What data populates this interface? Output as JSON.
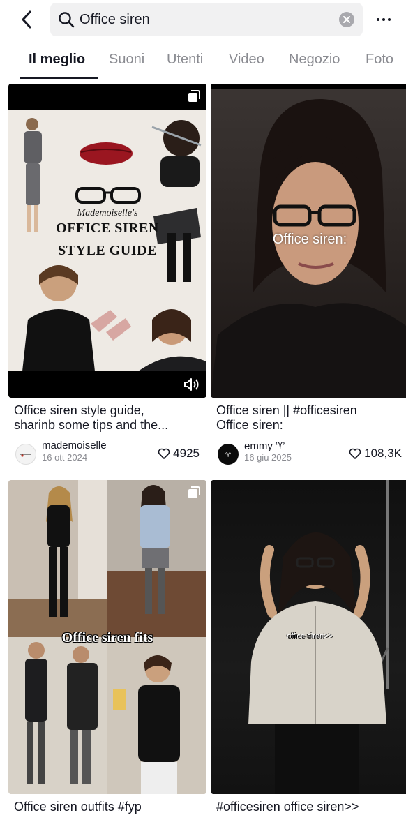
{
  "search": {
    "query": "Office siren"
  },
  "tabs": [
    {
      "label": "Il meglio",
      "active": true
    },
    {
      "label": "Suoni"
    },
    {
      "label": "Utenti"
    },
    {
      "label": "Video"
    },
    {
      "label": "Negozio"
    },
    {
      "label": "Foto"
    }
  ],
  "cards": [
    {
      "caption_line1": "Office siren style guide,",
      "caption_line2": "sharinb some tips and the...",
      "author": "mademoiselle",
      "date": "16 ott 2024",
      "likes": "4925",
      "thumb_text": {
        "line1": "Mademoiselle's",
        "line2": "OFFICE SIREN",
        "line3": "STYLE GUIDE"
      }
    },
    {
      "caption_line1": "Office siren || #officesiren",
      "caption_line2": "Office siren:",
      "author": "emmy ♈",
      "date": "16 giu 2025",
      "likes": "108,3K",
      "thumb_text": "Office siren:"
    },
    {
      "caption_line1": "Office siren outfits  #fyp",
      "thumb_text": "Office siren fits"
    },
    {
      "caption_line1": "#officesiren office siren>>",
      "thumb_text": "office siren>>"
    }
  ],
  "colors": {
    "text": "#161823",
    "muted": "#8a8b91",
    "search_bg": "#f1f1f2"
  }
}
